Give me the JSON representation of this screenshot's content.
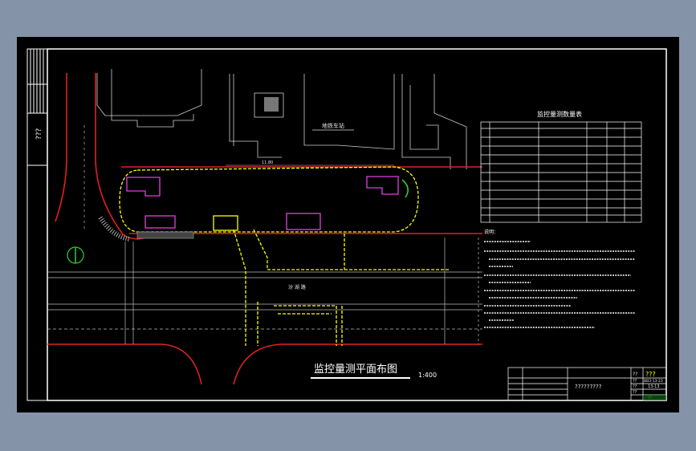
{
  "drawing": {
    "title": "监控量测平面布图",
    "scale": "1:400",
    "side_mark": "???",
    "table_title": "监控量测数量表"
  },
  "labels": {
    "station_text": "地铁车站",
    "width_dim": "11.80",
    "cross_street": "汾  湖  路"
  },
  "title_block": {
    "project": "?????????",
    "code_a": "??",
    "code_b": "???",
    "code_c": "??",
    "code_d": "ВВЗ-13-23",
    "code_e": "??",
    "code_f": "13-13",
    "code_g": "??",
    "code_h": "??"
  },
  "notes_heading": "说明：",
  "colors": {
    "background": "#000000",
    "road": "#e02020",
    "excavation": "#ffff00",
    "structure": "#e040e0",
    "text": "#ffffff",
    "title_block_green": "#3fd14a"
  }
}
